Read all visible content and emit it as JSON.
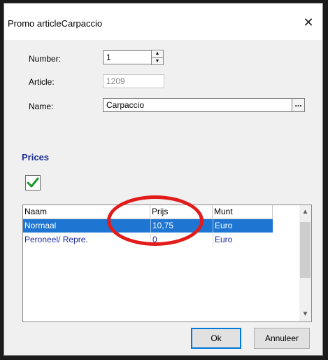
{
  "window": {
    "title": "Promo articleCarpaccio",
    "close_glyph": "✕"
  },
  "form": {
    "number_label": "Number:",
    "number_value": "1",
    "article_label": "Article:",
    "article_value": "1209",
    "name_label": "Name:",
    "name_value": "Carpaccio",
    "name_button_label": "..."
  },
  "prices": {
    "section_title": "Prices",
    "checkbox_checked": true,
    "columns": [
      "Naam",
      "Prijs",
      "Munt"
    ],
    "rows": [
      {
        "naam": "Normaal",
        "prijs": "10,75",
        "munt": "Euro",
        "selected": true
      },
      {
        "naam": "Peroneel/ Repre.",
        "prijs": "0",
        "munt": "Euro",
        "selected": false
      }
    ]
  },
  "buttons": {
    "ok": "Ok",
    "cancel": "Annuleer"
  },
  "colors": {
    "selection": "#1f76d2",
    "section_title": "#1f2f8f",
    "annotation": "#e21b1b"
  }
}
